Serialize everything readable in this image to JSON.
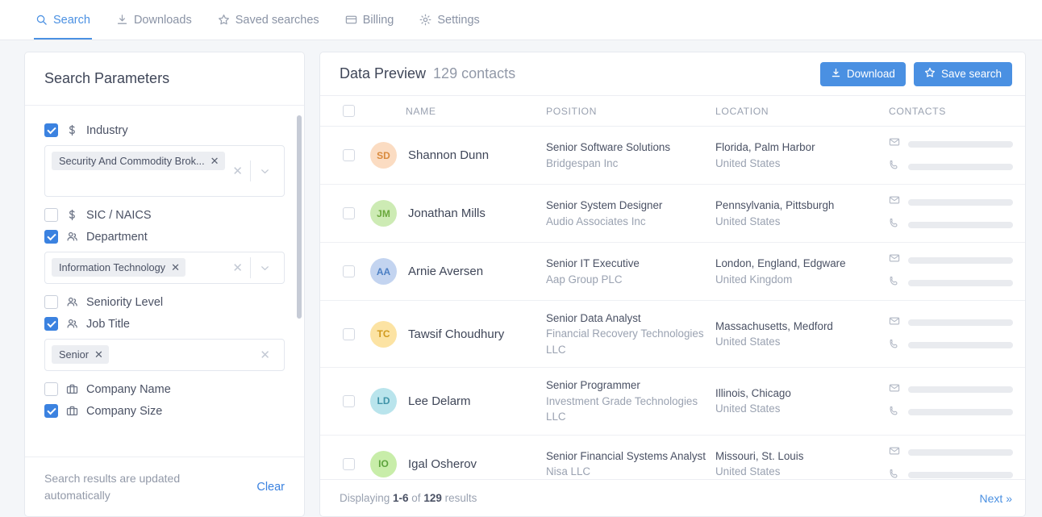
{
  "nav": {
    "items": [
      {
        "label": "Search",
        "icon": "search-icon",
        "active": true
      },
      {
        "label": "Downloads",
        "icon": "download-icon",
        "active": false
      },
      {
        "label": "Saved searches",
        "icon": "star-icon",
        "active": false
      },
      {
        "label": "Billing",
        "icon": "card-icon",
        "active": false
      },
      {
        "label": "Settings",
        "icon": "gear-icon",
        "active": false
      }
    ]
  },
  "sidebar": {
    "title": "Search Parameters",
    "params": [
      {
        "label": "Industry",
        "icon": "dollar-icon",
        "checked": true,
        "tags": [
          "Security And Commodity Brok..."
        ],
        "tall": true,
        "chevron": true
      },
      {
        "label": "SIC / NAICS",
        "icon": "dollar-icon",
        "checked": false
      },
      {
        "label": "Department",
        "icon": "people-icon",
        "checked": true,
        "tags": [
          "Information Technology"
        ],
        "tall": false,
        "chevron": true
      },
      {
        "label": "Seniority Level",
        "icon": "people-icon",
        "checked": false
      },
      {
        "label": "Job Title",
        "icon": "people-icon",
        "checked": true,
        "tags": [
          "Senior"
        ],
        "tall": false,
        "chevron": false
      },
      {
        "label": "Company Name",
        "icon": "briefcase-icon",
        "checked": false
      },
      {
        "label": "Company Size",
        "icon": "briefcase-icon",
        "checked": true
      }
    ],
    "footer_note": "Search results are updated automatically",
    "clear_label": "Clear"
  },
  "main": {
    "title": "Data Preview",
    "count_label": "129 contacts",
    "download_label": "Download",
    "save_search_label": "Save search",
    "columns": [
      "NAME",
      "POSITION",
      "LOCATION",
      "CONTACTS"
    ],
    "rows": [
      {
        "initials": "SD",
        "avatar_bg": "#fbdcc2",
        "avatar_fg": "#d98a3d",
        "name": "Shannon Dunn",
        "position": "Senior Software Solutions",
        "company": "Bridgespan Inc",
        "location": "Florida, Palm Harbor",
        "country": "United States"
      },
      {
        "initials": "JM",
        "avatar_bg": "#cdebb4",
        "avatar_fg": "#6aa83c",
        "name": "Jonathan Mills",
        "position": "Senior System Designer",
        "company": "Audio Associates Inc",
        "location": "Pennsylvania, Pittsburgh",
        "country": "United States"
      },
      {
        "initials": "AA",
        "avatar_bg": "#c3d4f0",
        "avatar_fg": "#4c7fc4",
        "name": "Arnie Aversen",
        "position": "Senior IT Executive",
        "company": "Aap Group PLC",
        "location": "London, England, Edgware",
        "country": "United Kingdom"
      },
      {
        "initials": "TC",
        "avatar_bg": "#fce3a3",
        "avatar_fg": "#d19a1e",
        "name": "Tawsif Choudhury",
        "position": "Senior Data Analyst",
        "company": "Financial Recovery Technologies LLC",
        "location": "Massachusetts, Medford",
        "country": "United States"
      },
      {
        "initials": "LD",
        "avatar_bg": "#b9e4ec",
        "avatar_fg": "#3f93a8",
        "name": "Lee Delarm",
        "position": "Senior Programmer",
        "company": "Investment Grade Technologies LLC",
        "location": "Illinois, Chicago",
        "country": "United States"
      },
      {
        "initials": "IO",
        "avatar_bg": "#c8eda9",
        "avatar_fg": "#5ca33b",
        "name": "Igal Osherov",
        "position": "Senior Financial Systems Analyst",
        "company": "Nisa LLC",
        "location": "Missouri, St. Louis",
        "country": "United States"
      }
    ],
    "footer": {
      "prefix": "Displaying ",
      "range": "1-6",
      "middle": " of ",
      "total": "129",
      "suffix": " results",
      "next_label": "Next"
    }
  },
  "colors": {
    "accent": "#4a90e2",
    "page_bg": "#f4f6f9",
    "panel_bg": "#ffffff"
  }
}
